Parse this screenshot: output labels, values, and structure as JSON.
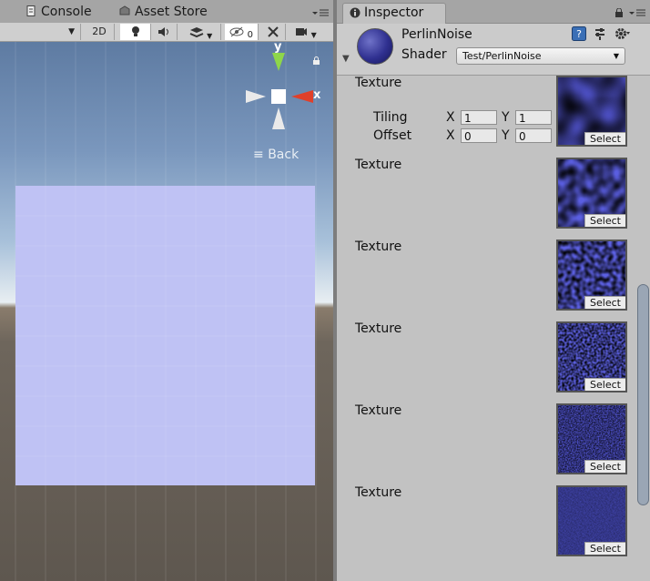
{
  "scene_tabs": [
    {
      "label": "Console",
      "icon": "console-icon"
    },
    {
      "label": "Asset Store",
      "icon": "asset-store-icon"
    }
  ],
  "scene_toolbar": {
    "mode_2d": "2D",
    "hidden_count": "0"
  },
  "scene_view": {
    "gizmo": {
      "y": "y",
      "x": "x"
    },
    "back_label": "Back"
  },
  "inspector": {
    "tab_label": "Inspector",
    "material_name": "PerlinNoise",
    "shader_label": "Shader",
    "shader_value": "Test/PerlinNoise",
    "textures": [
      {
        "label": "Texture",
        "select": "Select"
      },
      {
        "label": "Texture",
        "select": "Select"
      },
      {
        "label": "Texture",
        "select": "Select"
      },
      {
        "label": "Texture",
        "select": "Select"
      },
      {
        "label": "Texture",
        "select": "Select"
      },
      {
        "label": "Texture",
        "select": "Select"
      }
    ],
    "tiling": {
      "label": "Tiling",
      "x_label": "X",
      "x": "1",
      "y_label": "Y",
      "y": "1"
    },
    "offset": {
      "label": "Offset",
      "x_label": "X",
      "x": "0",
      "y_label": "Y",
      "y": "0"
    }
  },
  "colors": {
    "noise_dark": "#14164e",
    "noise_mid": "#3c40b4",
    "noise_light": "#7a80ea"
  }
}
